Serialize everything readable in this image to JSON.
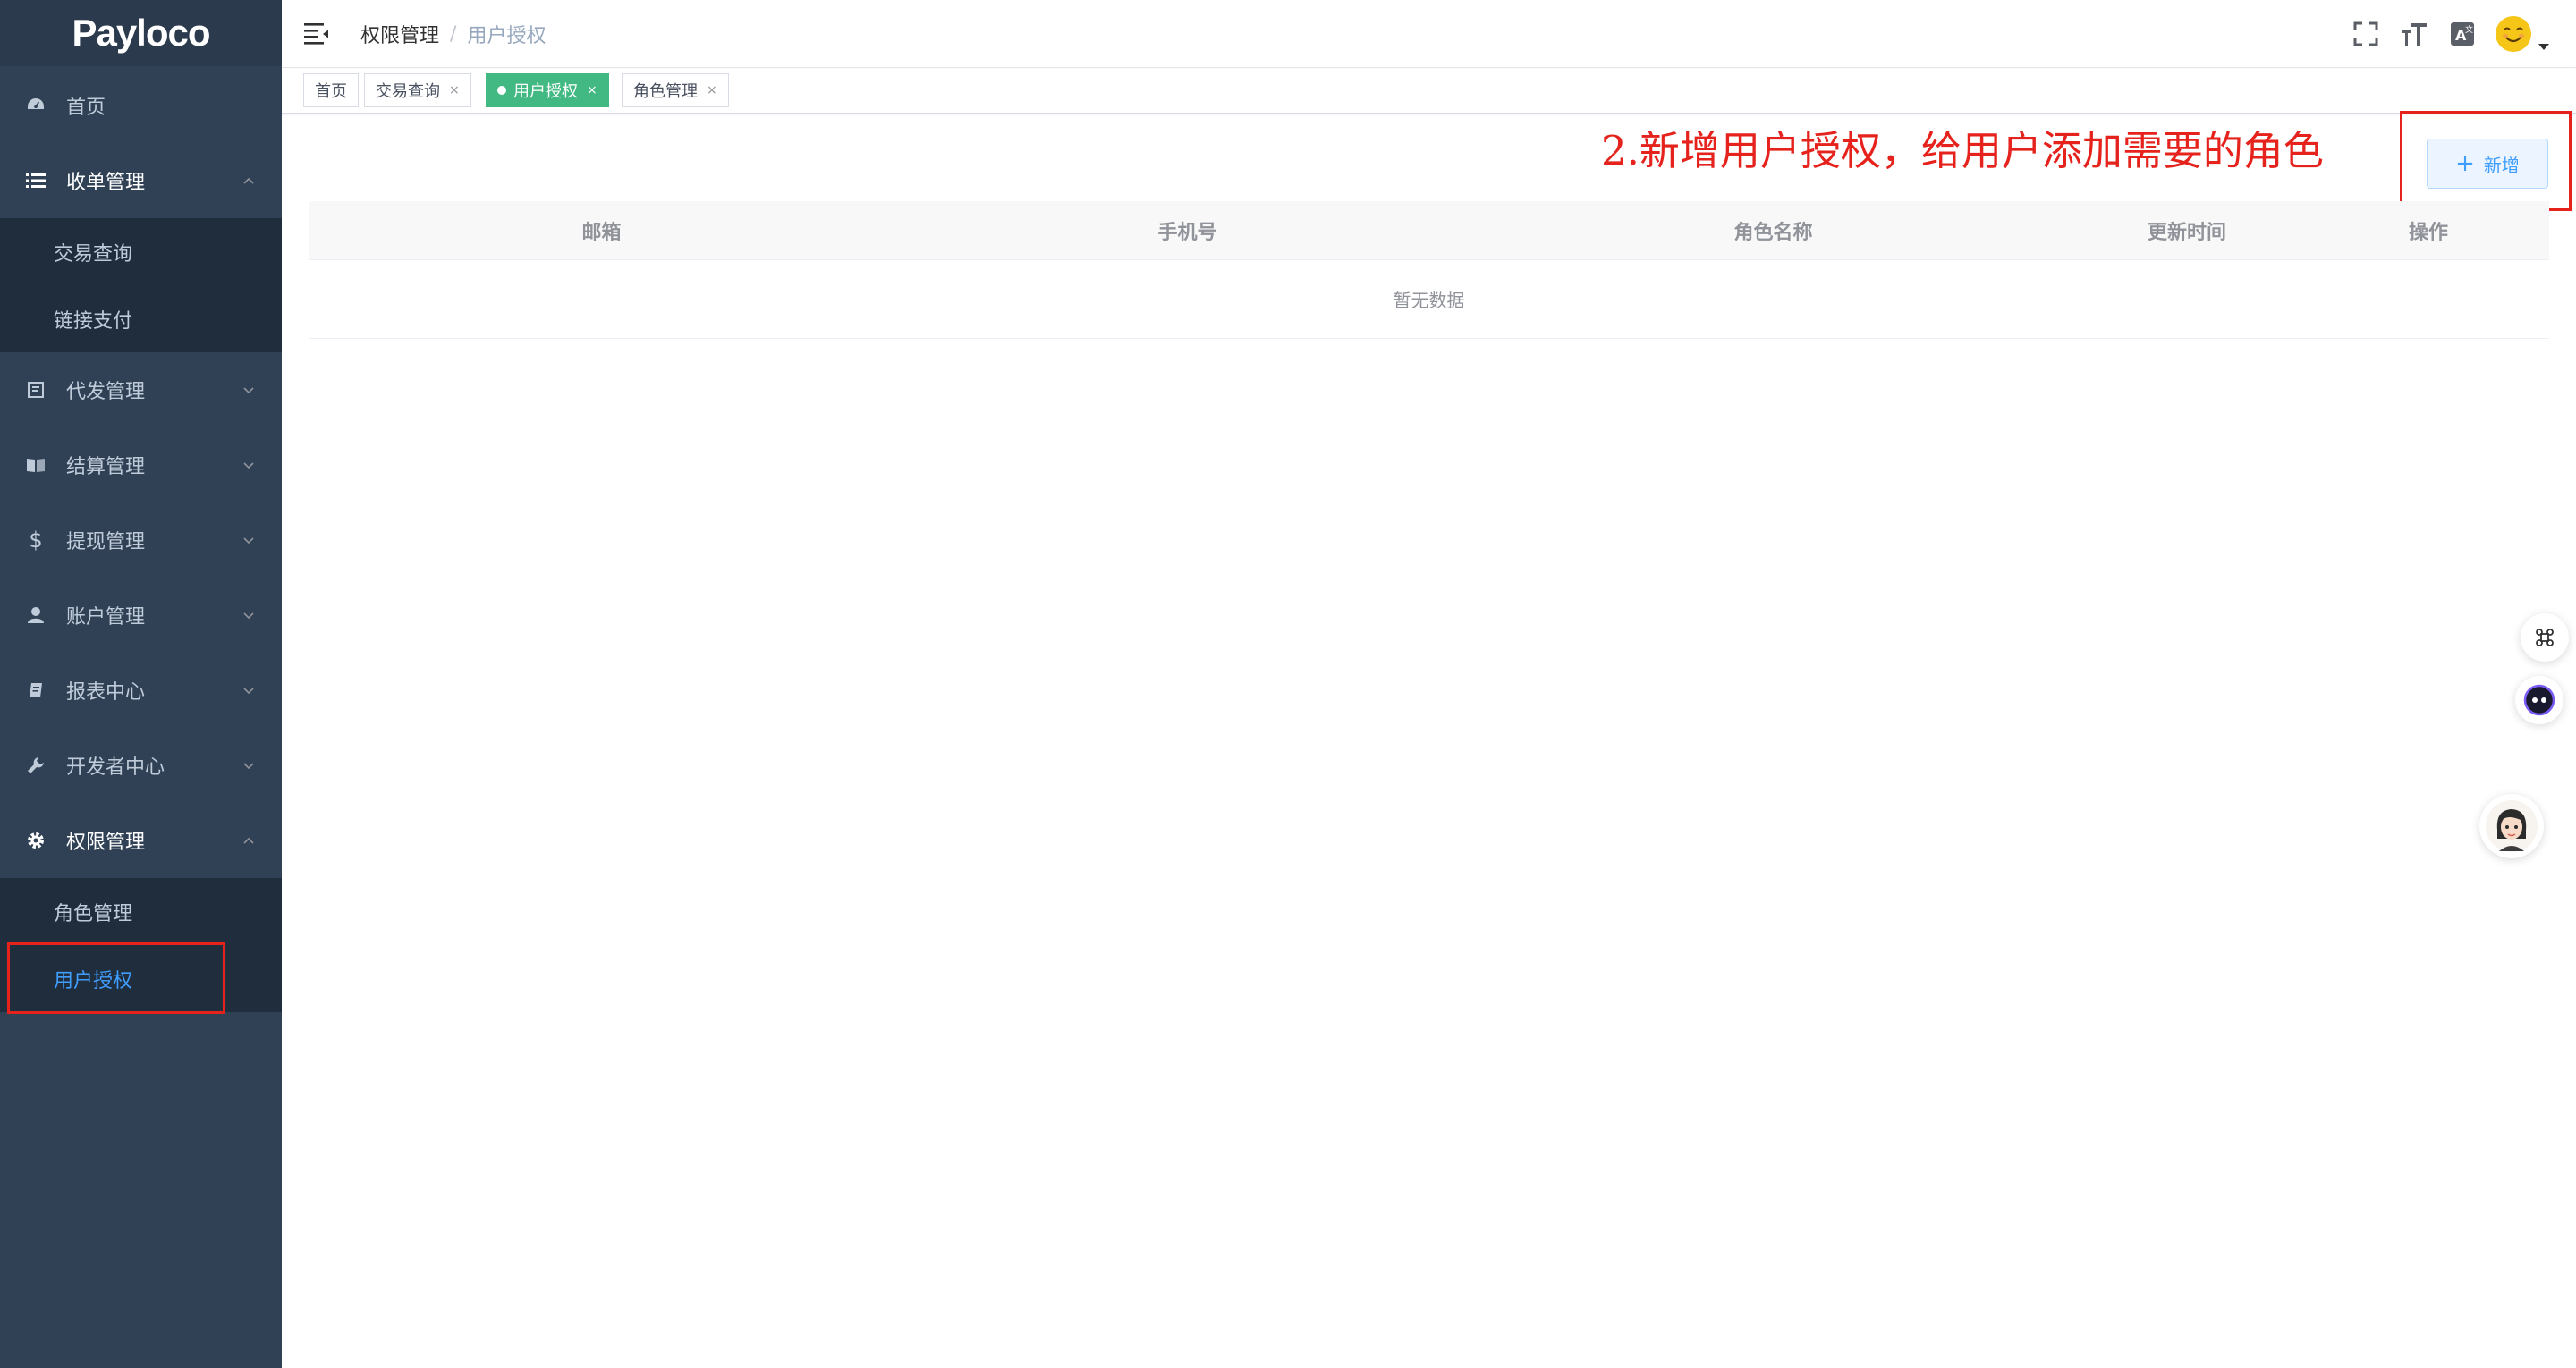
{
  "app": {
    "logo_text": "Payloco"
  },
  "sidebar": {
    "items": [
      {
        "label": "首页",
        "icon": "dashboard-icon"
      },
      {
        "label": "收单管理",
        "icon": "list-icon",
        "expanded": true,
        "children": [
          {
            "label": "交易查询"
          },
          {
            "label": "链接支付"
          }
        ]
      },
      {
        "label": "代发管理",
        "icon": "document-icon"
      },
      {
        "label": "结算管理",
        "icon": "book-icon"
      },
      {
        "label": "提现管理",
        "icon": "dollar-icon"
      },
      {
        "label": "账户管理",
        "icon": "user-icon"
      },
      {
        "label": "报表中心",
        "icon": "report-icon"
      },
      {
        "label": "开发者中心",
        "icon": "wrench-icon"
      },
      {
        "label": "权限管理",
        "icon": "gear-icon",
        "expanded": true,
        "children": [
          {
            "label": "角色管理"
          },
          {
            "label": "用户授权",
            "active": true
          }
        ]
      }
    ]
  },
  "navbar": {
    "breadcrumb": [
      "权限管理",
      "用户授权"
    ],
    "breadcrumb_separator": "/",
    "icons": [
      "fullscreen-icon",
      "font-size-icon",
      "translate-icon"
    ]
  },
  "tags": [
    {
      "label": "首页",
      "closable": false
    },
    {
      "label": "交易查询",
      "closable": true
    },
    {
      "label": "用户授权",
      "closable": true,
      "active": true
    },
    {
      "label": "角色管理",
      "closable": true
    }
  ],
  "tag_close_glyph": "×",
  "annotation": {
    "text": "2.新增用户授权，给用户添加需要的角色",
    "color": "#e5221c"
  },
  "toolbar": {
    "add_label": "新增",
    "add_glyph": "+"
  },
  "table": {
    "columns": [
      "邮箱",
      "手机号",
      "角色名称",
      "更新时间",
      "操作"
    ],
    "empty_text": "暂无数据"
  },
  "colors": {
    "sidebar_bg": "#304156",
    "submenu_bg": "#1f2d3d",
    "active_menu": "#409eff",
    "active_tag": "#42b983",
    "annotation_red": "#e5221c"
  }
}
